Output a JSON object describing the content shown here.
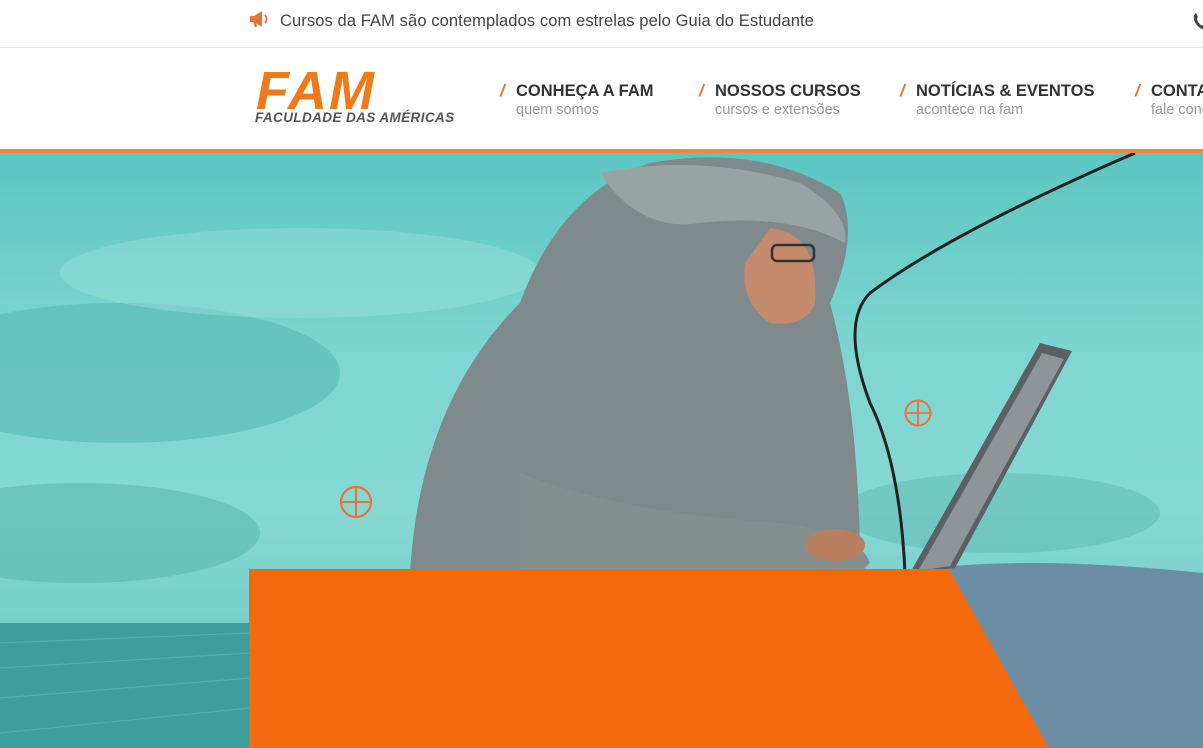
{
  "announcement": {
    "text": "Cursos da FAM são contemplados com estrelas pelo Guia do Estudante",
    "icon": "megaphone-icon",
    "icon_color": "#e8733a"
  },
  "utility": {
    "icon": "phone-icon"
  },
  "logo": {
    "wordmark": "FAM",
    "subtitle": "FACULDADE DAS AMÉRICAS",
    "color": "#f07a1a"
  },
  "nav": {
    "items": [
      {
        "label": "CONHEÇA A FAM",
        "sub": "quem somos"
      },
      {
        "label": "NOSSOS CURSOS",
        "sub": "cursos e extensões"
      },
      {
        "label": "NOTÍCIAS & EVENTOS",
        "sub": "acontece na fam"
      },
      {
        "label": "CONTATO",
        "sub": "fale conosco"
      }
    ],
    "accent": "#e8733a"
  },
  "hero": {
    "background": "#7fd6d2",
    "panel_color": "#f26a0d",
    "target_icon": "crosshair-icon"
  }
}
